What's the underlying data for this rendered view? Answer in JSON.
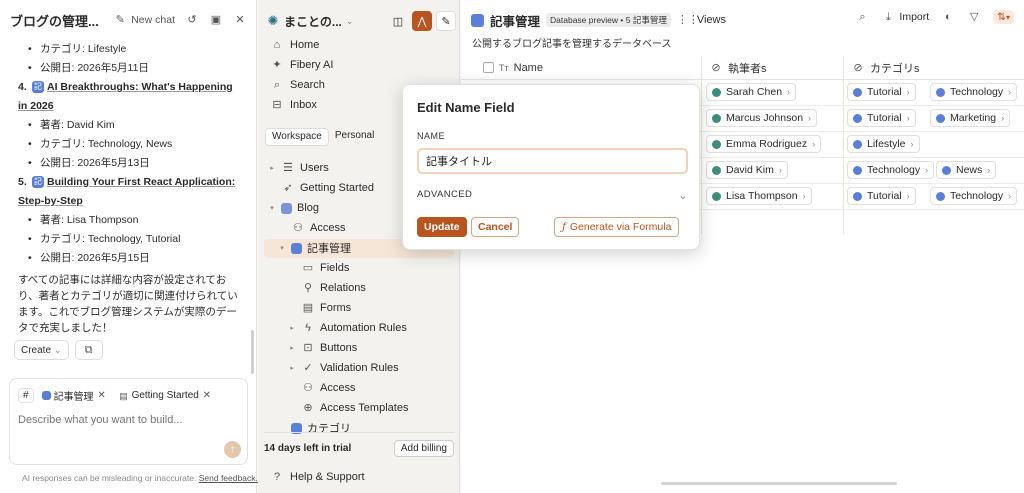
{
  "chat": {
    "title": "ブログの管理...",
    "new_chat": "New chat",
    "list": [
      {
        "type": "sub",
        "text": "カテゴリ: Lifestyle"
      },
      {
        "type": "sub",
        "text": "公開日: 2026年5月11日"
      },
      {
        "type": "post",
        "num": "4.",
        "badge": "記",
        "title": "AI Breakthroughs: What's Happening in 2026"
      },
      {
        "type": "sub",
        "text": "著者: David Kim"
      },
      {
        "type": "sub",
        "text": "カテゴリ: Technology, News"
      },
      {
        "type": "sub",
        "text": "公開日: 2026年5月13日"
      },
      {
        "type": "post",
        "num": "5.",
        "badge": "記",
        "title": "Building Your First React Application: Step-by-Step"
      },
      {
        "type": "sub",
        "text": "著者: Lisa Thompson"
      },
      {
        "type": "sub",
        "text": "カテゴリ: Technology, Tutorial"
      },
      {
        "type": "sub",
        "text": "公開日: 2026年5月15日"
      }
    ],
    "summary": "すべての記事には詳細な内容が設定されており、著者とカテゴリが適切に関連付けられています。これでブログ管理システムが実際のデータで充実しました！",
    "create_label": "Create",
    "composer": {
      "hash": "#",
      "tag1": "記事管理",
      "tag2": "Getting Started",
      "placeholder": "Describe what you want to build..."
    },
    "disclaimer": "AI responses can be misleading or inaccurate.",
    "feedback": "Send feedback."
  },
  "nav": {
    "workspace": "まことの...",
    "items": [
      "Home",
      "Fibery AI",
      "Search",
      "Inbox"
    ],
    "tabs": [
      "Workspace",
      "Personal"
    ],
    "tree": [
      {
        "label": "Users",
        "caret": "▸",
        "indent": 0,
        "icon": "db-stack"
      },
      {
        "label": "Getting Started",
        "caret": "",
        "indent": 0,
        "icon": "rocket"
      },
      {
        "label": "Blog",
        "caret": "▾",
        "indent": 0,
        "icon": "blog"
      },
      {
        "label": "Access",
        "caret": "",
        "indent": 1,
        "icon": "people"
      },
      {
        "label": "記事管理",
        "caret": "▾",
        "indent": 1,
        "icon": "db-blue"
      },
      {
        "label": "Fields",
        "caret": "",
        "indent": 2,
        "icon": "fields"
      },
      {
        "label": "Relations",
        "caret": "",
        "indent": 2,
        "icon": "relations"
      },
      {
        "label": "Forms",
        "caret": "",
        "indent": 2,
        "icon": "forms"
      },
      {
        "label": "Automation Rules",
        "caret": "▸",
        "indent": 2,
        "icon": "bolt"
      },
      {
        "label": "Buttons",
        "caret": "▸",
        "indent": 2,
        "icon": "button"
      },
      {
        "label": "Validation Rules",
        "caret": "▸",
        "indent": 2,
        "icon": "check"
      },
      {
        "label": "Access",
        "caret": "",
        "indent": 2,
        "icon": "people"
      },
      {
        "label": "Access Templates",
        "caret": "",
        "indent": 2,
        "icon": "template"
      },
      {
        "label": "カテゴリ",
        "caret": "",
        "indent": 1,
        "icon": "db-blue"
      }
    ],
    "trial": "14 days left in trial",
    "add_billing": "Add billing",
    "help": "Help & Support"
  },
  "main": {
    "title": "記事管理",
    "badge": "Database preview • 5 記事管理",
    "views": "Views",
    "description": "公開するブログ記事を管理するデータベース",
    "import": "Import",
    "columns": {
      "name": "Name",
      "authors": "執筆者s",
      "categories": "カテゴリs"
    },
    "rows": [
      {
        "author": "Sarah Chen",
        "cats": [
          "Tutorial",
          "Technology"
        ]
      },
      {
        "author": "Marcus Johnson",
        "cats": [
          "Tutorial",
          "Marketing"
        ]
      },
      {
        "author": "Emma Rodriguez",
        "cats": [
          "Lifestyle"
        ]
      },
      {
        "author": "David Kim",
        "cats": [
          "Technology",
          "News"
        ]
      },
      {
        "author": "Lisa Thompson",
        "cats": [
          "Tutorial",
          "Technology"
        ]
      }
    ]
  },
  "modal": {
    "title": "Edit Name Field",
    "field_label": "NAME",
    "value": "記事タイトル",
    "advanced": "ADVANCED",
    "update": "Update",
    "cancel": "Cancel",
    "formula": "Generate via Formula"
  },
  "colors": {
    "accent": "#b8541f",
    "author_dot": "#3e8e7e",
    "category_dot": "#5b7fd6"
  }
}
